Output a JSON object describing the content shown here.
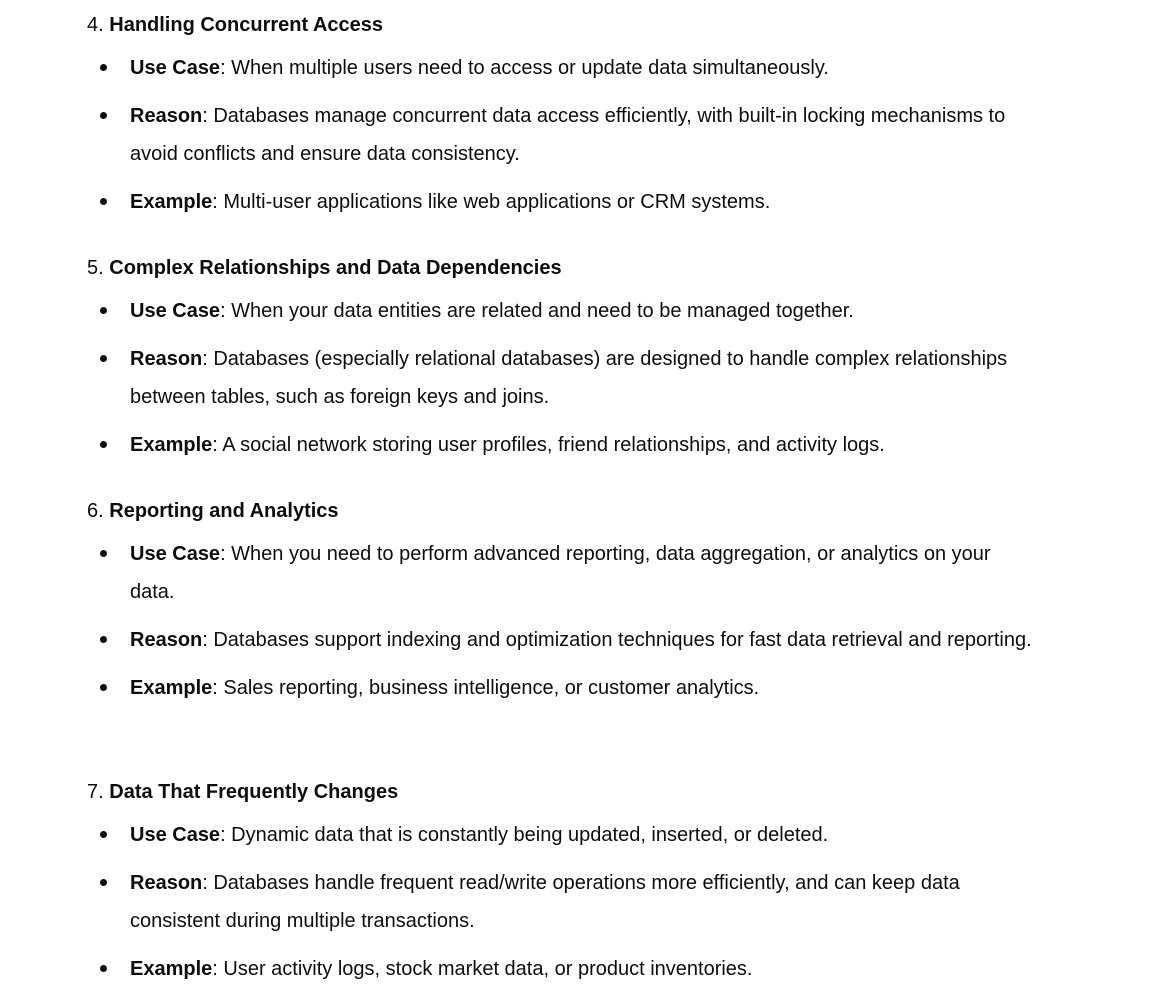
{
  "sections": [
    {
      "number": "4.",
      "title": "Handling Concurrent Access",
      "items": [
        {
          "term": "Use Case",
          "text": ": When multiple users need to access or update data simultaneously."
        },
        {
          "term": "Reason",
          "text": ": Databases manage concurrent data access efficiently, with built-in locking mechanisms to avoid conflicts and ensure data consistency."
        },
        {
          "term": "Example",
          "text": ": Multi-user applications like web applications or CRM systems."
        }
      ]
    },
    {
      "number": "5.",
      "title": "Complex Relationships and Data Dependencies",
      "items": [
        {
          "term": "Use Case",
          "text": ": When your data entities are related and need to be managed together."
        },
        {
          "term": "Reason",
          "text": ": Databases (especially relational databases) are designed to handle complex relationships between tables, such as foreign keys and joins."
        },
        {
          "term": "Example",
          "text": ": A social network storing user profiles, friend relationships, and activity logs."
        }
      ]
    },
    {
      "number": "6.",
      "title": "Reporting and Analytics",
      "items": [
        {
          "term": "Use Case",
          "text": ": When you need to perform advanced reporting, data aggregation, or analytics on your data."
        },
        {
          "term": "Reason",
          "text": ": Databases support indexing and optimization techniques for fast data retrieval and reporting."
        },
        {
          "term": "Example",
          "text": ": Sales reporting, business intelligence, or customer analytics."
        }
      ]
    },
    {
      "number": "7.",
      "title": "Data That Frequently Changes",
      "items": [
        {
          "term": "Use Case",
          "text": ": Dynamic data that is constantly being updated, inserted, or deleted."
        },
        {
          "term": "Reason",
          "text": ": Databases handle frequent read/write operations more efficiently, and can keep data consistent during multiple transactions."
        },
        {
          "term": "Example",
          "text": ": User activity logs, stock market data, or product inventories."
        }
      ]
    }
  ]
}
